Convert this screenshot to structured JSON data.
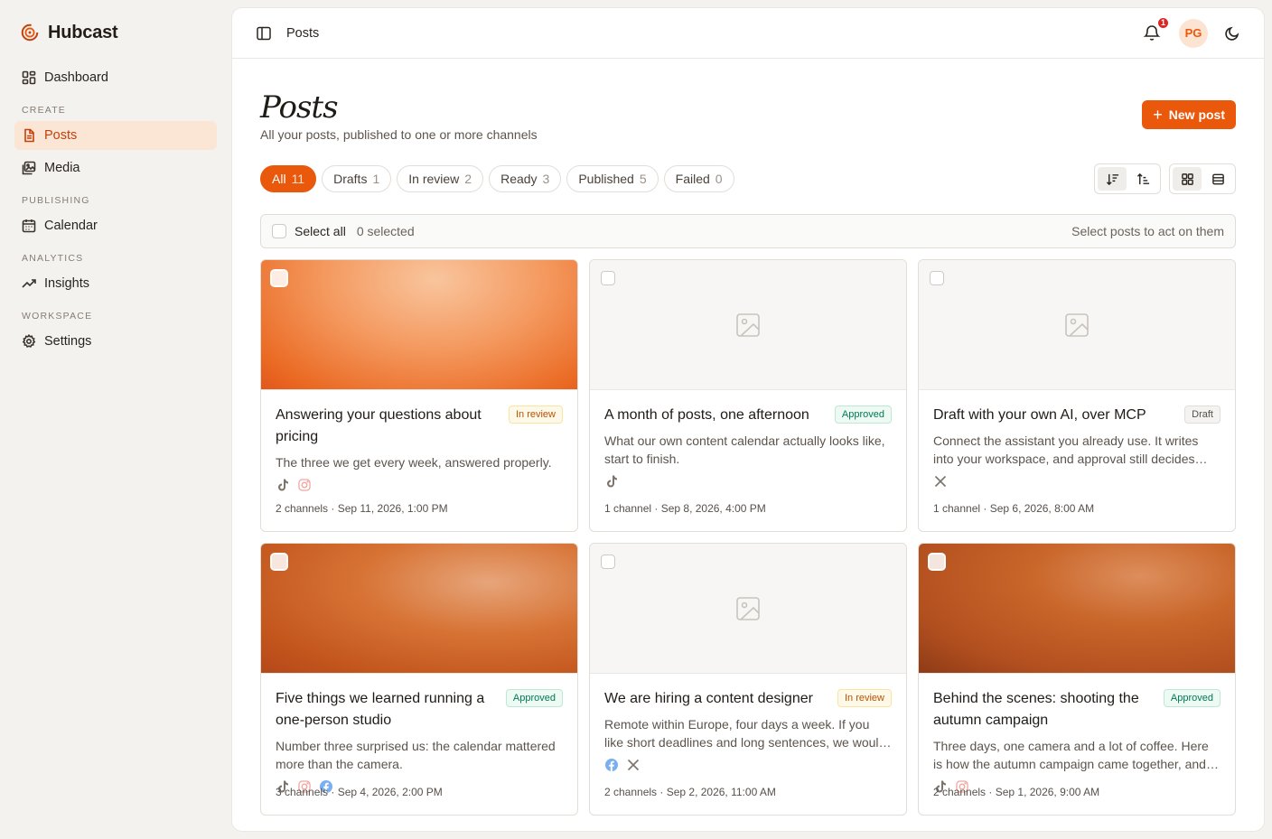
{
  "brand": {
    "name": "Hubcast"
  },
  "sidebar": {
    "dashboard": "Dashboard",
    "sections": {
      "create": "CREATE",
      "publishing": "PUBLISHING",
      "analytics": "ANALYTICS",
      "workspace": "WORKSPACE"
    },
    "posts": "Posts",
    "media": "Media",
    "calendar": "Calendar",
    "insights": "Insights",
    "settings": "Settings"
  },
  "topbar": {
    "breadcrumb": "Posts",
    "notification_count": "1",
    "avatar_initials": "PG"
  },
  "page": {
    "title": "Posts",
    "subtitle": "All your posts, published to one or more channels",
    "new_post_label": "New post"
  },
  "filters": [
    {
      "label": "All",
      "count": "11",
      "active": true
    },
    {
      "label": "Drafts",
      "count": "1"
    },
    {
      "label": "In review",
      "count": "2"
    },
    {
      "label": "Ready",
      "count": "3"
    },
    {
      "label": "Published",
      "count": "5"
    },
    {
      "label": "Failed",
      "count": "0"
    }
  ],
  "selection": {
    "select_all": "Select all",
    "selected": "0 selected",
    "hint": "Select posts to act on them"
  },
  "posts": [
    {
      "title": "Answering your questions about pricing",
      "status": "In review",
      "desc": "The three we get every week, answered properly.",
      "meta": "2 channels · Sep 11, 2026, 1:00 PM"
    },
    {
      "title": "A month of posts, one afternoon",
      "status": "Approved",
      "desc": "What our own content calendar actually looks like, start to finish.",
      "meta": "1 channel · Sep 8, 2026, 4:00 PM"
    },
    {
      "title": "Draft with your own AI, over MCP",
      "status": "Draft",
      "desc": "Connect the assistant you already use. It writes into your workspace, and approval still decides what goes out.",
      "meta": "1 channel · Sep 6, 2026, 8:00 AM"
    },
    {
      "title": "Five things we learned running a one-person studio",
      "status": "Approved",
      "desc": "Number three surprised us: the calendar mattered more than the camera.",
      "meta": "3 channels · Sep 4, 2026, 2:00 PM"
    },
    {
      "title": "We are hiring a content designer",
      "status": "In review",
      "desc": "Remote within Europe, four days a week. If you like short deadlines and long sentences, we would love to hear from you.",
      "meta": "2 channels · Sep 2, 2026, 11:00 AM"
    },
    {
      "title": "Behind the scenes: shooting the autumn campaign",
      "status": "Approved",
      "desc": "Three days, one camera and a lot of coffee. Here is how the autumn campaign came together, and what we would do differently.",
      "meta": "2 channels · Sep 1, 2026, 9:00 AM"
    }
  ],
  "colors": {
    "accent": "#ea580c",
    "active_nav_bg": "#fbe6d6"
  }
}
